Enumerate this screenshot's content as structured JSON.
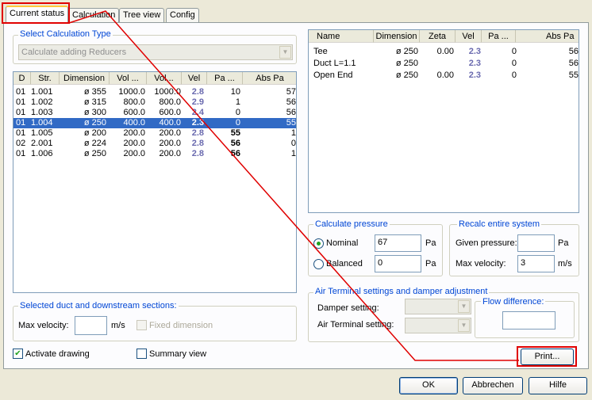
{
  "tabs": [
    {
      "label": "Current status",
      "active": true
    },
    {
      "label": "Calculation",
      "active": false
    },
    {
      "label": "Tree view",
      "active": false
    },
    {
      "label": "Config",
      "active": false
    }
  ],
  "calc_type": {
    "title": "Select Calculation Type",
    "selected": "Calculate adding Reducers"
  },
  "ducts": {
    "columns": [
      "D",
      "Str.",
      "Dimension",
      "Vol ...",
      "Vol...",
      "Vel",
      "Pa ...",
      "Abs Pa"
    ],
    "rows": [
      {
        "d": "01",
        "str": "1.001",
        "dim": "ø 355",
        "vol1": "1000.0",
        "vol2": "1000.0",
        "vel": "2.8",
        "pa": "10",
        "abs": "57",
        "bold": false,
        "selected": false
      },
      {
        "d": "01",
        "str": "1.002",
        "dim": "ø 315",
        "vol1": "800.0",
        "vol2": "800.0",
        "vel": "2.9",
        "pa": "1",
        "abs": "56",
        "bold": false,
        "selected": false
      },
      {
        "d": "01",
        "str": "1.003",
        "dim": "ø 300",
        "vol1": "600.0",
        "vol2": "600.0",
        "vel": "2.4",
        "pa": "0",
        "abs": "56",
        "bold": false,
        "selected": false
      },
      {
        "d": "01",
        "str": "1.004",
        "dim": "ø 250",
        "vol1": "400.0",
        "vol2": "400.0",
        "vel": "2.3",
        "pa": "0",
        "abs": "55",
        "bold": false,
        "selected": true
      },
      {
        "d": "01",
        "str": "1.005",
        "dim": "ø 200",
        "vol1": "200.0",
        "vol2": "200.0",
        "vel": "2.8",
        "pa": "55",
        "abs": "1",
        "bold": true,
        "selected": false
      },
      {
        "d": "02",
        "str": "2.001",
        "dim": "ø 224",
        "vol1": "200.0",
        "vol2": "200.0",
        "vel": "2.8",
        "pa": "56",
        "abs": "0",
        "bold": true,
        "selected": false
      },
      {
        "d": "01",
        "str": "1.006",
        "dim": "ø 250",
        "vol1": "200.0",
        "vol2": "200.0",
        "vel": "2.8",
        "pa": "56",
        "abs": "1",
        "bold": true,
        "selected": false
      }
    ]
  },
  "components": {
    "columns": [
      "Name",
      "Dimension",
      "Zeta",
      "Vel",
      "Pa ...",
      "Abs Pa"
    ],
    "rows": [
      {
        "name": "Tee",
        "dim": "ø 250",
        "zeta": "0.00",
        "vel": "2.3",
        "pa": "0",
        "abs": "56"
      },
      {
        "name": "Duct L=1.1",
        "dim": "ø 250",
        "zeta": "",
        "vel": "2.3",
        "pa": "0",
        "abs": "56"
      },
      {
        "name": "Open End",
        "dim": "ø 250",
        "zeta": "0.00",
        "vel": "2.3",
        "pa": "0",
        "abs": "55"
      }
    ]
  },
  "calc_pressure": {
    "title": "Calculate pressure",
    "nominal_label": "Nominal",
    "nominal_value": "67",
    "balanced_label": "Balanced",
    "balanced_value": "0",
    "unit": "Pa",
    "selected": "nominal"
  },
  "recalc": {
    "title": "Recalc entire system",
    "given_label": "Given pressure:",
    "given_value": "",
    "given_unit": "Pa",
    "maxvel_label": "Max velocity:",
    "maxvel_value": "3",
    "maxvel_unit": "m/s"
  },
  "selected_duct": {
    "title": "Selected duct and downstream sections:",
    "maxvel_label": "Max velocity:",
    "maxvel_value": "",
    "unit": "m/s",
    "fixed_label": "Fixed dimension"
  },
  "air_terminal": {
    "title": "Air Terminal settings and damper adjustment",
    "damper_label": "Damper setting:",
    "terminal_label": "Air Terminal setting:",
    "flow_title": "Flow difference:"
  },
  "checkboxes": {
    "activate_label": "Activate drawing",
    "activate_checked": true,
    "summary_label": "Summary view",
    "summary_checked": false
  },
  "buttons": {
    "print": "Print...",
    "ok": "OK",
    "cancel": "Abbrechen",
    "help": "Hilfe"
  },
  "colors": {
    "annotation": "#e00000",
    "selection": "#316ac5",
    "velocity": "#6a6aaf",
    "group_title": "#0046d5"
  },
  "checkmark": "✔",
  "dropdown_arrow": "▼"
}
